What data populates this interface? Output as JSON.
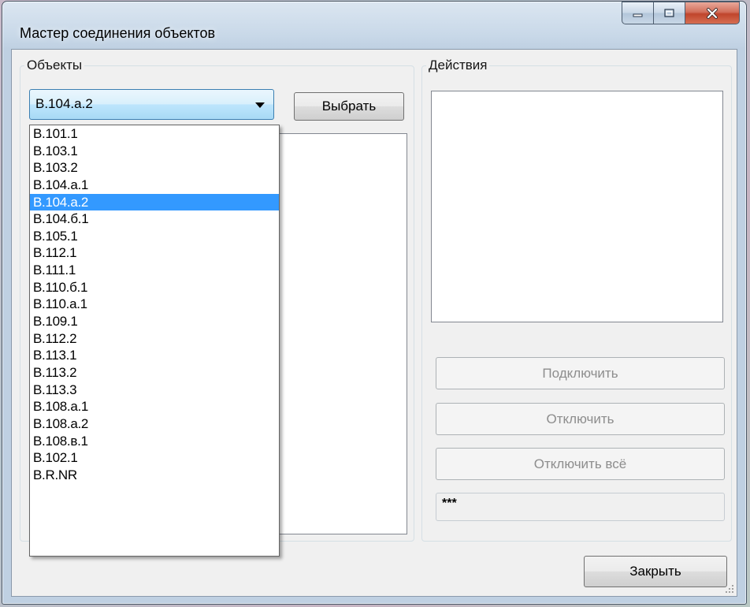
{
  "window": {
    "title": "Мастер соединения объектов"
  },
  "objects_group": {
    "title": "Объекты",
    "combo_value": "B.104.a.2",
    "select_button": "Выбрать",
    "dropdown_items": [
      "B.101.1",
      "B.103.1",
      "B.103.2",
      "B.104.a.1",
      "B.104.a.2",
      "B.104.б.1",
      "B.105.1",
      "B.112.1",
      "B.111.1",
      "B.110.б.1",
      "B.110.a.1",
      "B.109.1",
      "B.112.2",
      "B.113.1",
      "B.113.2",
      "B.113.3",
      "B.108.a.1",
      "B.108.a.2",
      "B.108.в.1",
      "B.102.1",
      "B.R.NR"
    ],
    "selected_index": 4
  },
  "actions_group": {
    "title": "Действия",
    "connect_button": "Подключить",
    "disconnect_button": "Отключить",
    "disconnect_all_button": "Отключить всё",
    "status_text": "***"
  },
  "footer": {
    "close_button": "Закрыть"
  },
  "icons": {
    "minimize": "minimize-icon",
    "maximize": "maximize-icon",
    "close": "close-icon",
    "dropdown": "chevron-down-icon",
    "resize": "resize-grip-icon"
  },
  "colors": {
    "selection": "#3399ff",
    "close_button": "#c0452c",
    "combo_border": "#3c7fb1",
    "disabled_text": "#8d8d8d"
  }
}
